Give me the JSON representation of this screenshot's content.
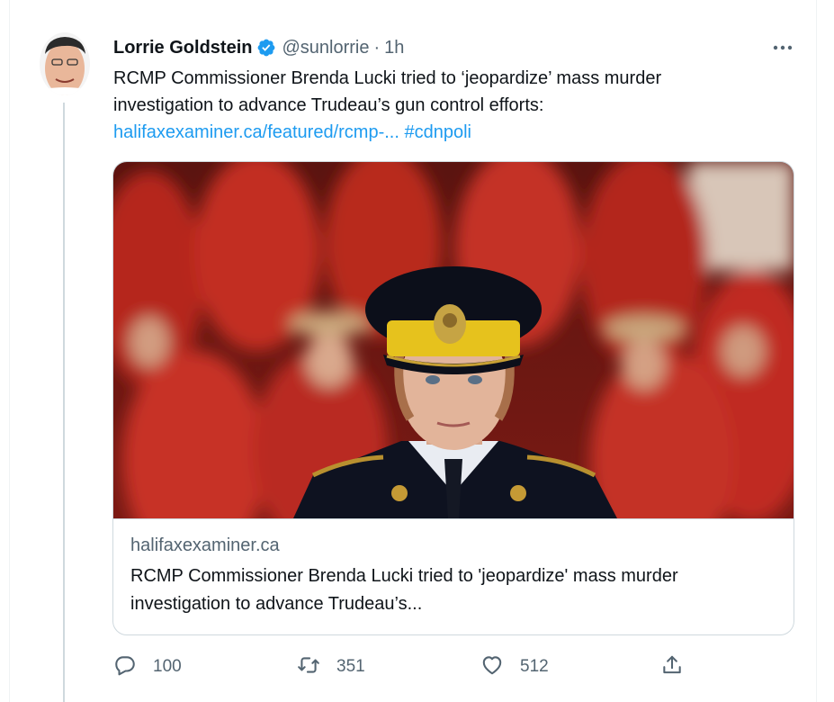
{
  "tweet": {
    "display_name": "Lorrie Goldstein",
    "handle": "@sunlorrie",
    "separator": "·",
    "time": "1h",
    "text_lines": [
      "RCMP Commissioner Brenda Lucki tried to ‘jeopardize’ mass murder",
      "investigation to advance Trudeau’s gun control efforts:"
    ],
    "link_text": "halifaxexaminer.ca/featured/rcmp-...",
    "hashtag": "#cdnpoli"
  },
  "card": {
    "domain": "halifaxexaminer.ca",
    "title_lines": [
      "RCMP Commissioner Brenda Lucki tried to 'jeopardize' mass murder",
      "investigation to advance Trudeau’s..."
    ]
  },
  "actions": {
    "reply_count": "100",
    "retweet_count": "351",
    "like_count": "512"
  },
  "icons": {
    "verified": "verified-badge-icon",
    "more": "more-options-icon",
    "reply": "reply-icon",
    "retweet": "retweet-icon",
    "like": "heart-icon",
    "share": "share-icon"
  },
  "colors": {
    "link": "#1d9bf0",
    "verified": "#1d9bf0",
    "secondary_text": "#536471",
    "primary_text": "#0f1419",
    "border": "#cfd9de"
  }
}
